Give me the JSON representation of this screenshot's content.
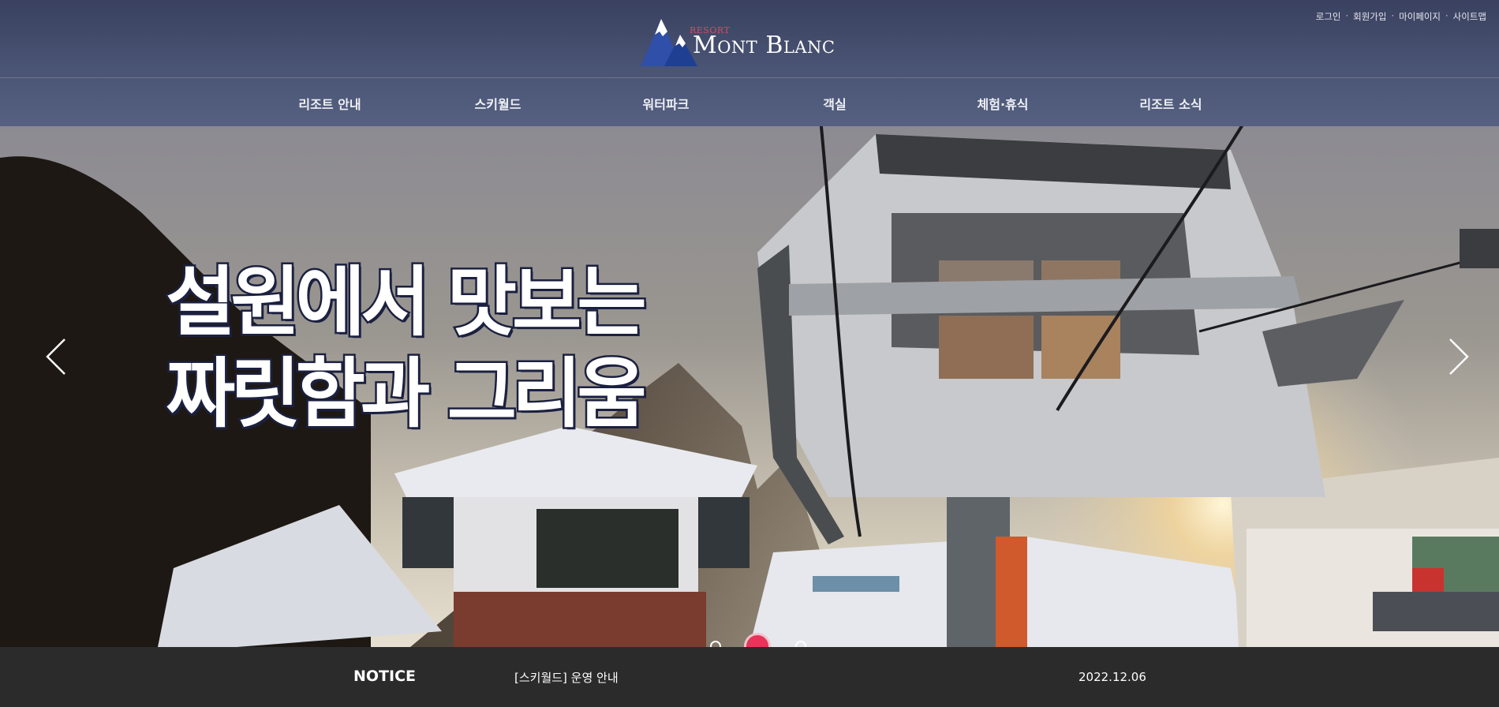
{
  "header": {
    "logo": {
      "small_text": "RESORT",
      "main_text": "Mont Blanc",
      "icon": "mountain-logo-icon"
    },
    "util_links": [
      "로그인",
      "회원가입",
      "마이페이지",
      "사이트맵"
    ],
    "util_separator": "·",
    "nav": [
      "리조트 안내",
      "스키월드",
      "워터파크",
      "객실",
      "체험·휴식",
      "리조트 소식"
    ]
  },
  "hero": {
    "headline_line1": "설원에서 맛보는",
    "headline_line2": "짜릿함과 그리움",
    "prev_icon": "chevron-left-icon",
    "next_icon": "chevron-right-icon",
    "slide_count": 3,
    "active_slide": 2
  },
  "notice": {
    "label": "NOTICE",
    "title": "[스키월드] 운영 안내",
    "date": "2022.12.06"
  },
  "colors": {
    "header_bg": "#4a5474",
    "notice_bg": "#2b2b2b",
    "active_dot": "#e8335a",
    "headline_stroke": "#1c2140"
  }
}
